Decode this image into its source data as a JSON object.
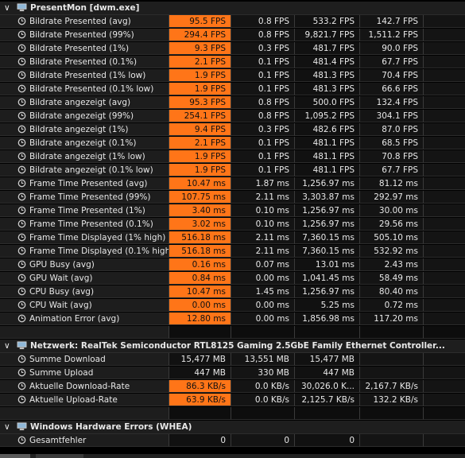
{
  "sections": [
    {
      "title": "PresentMon [dwm.exe]",
      "rows": [
        {
          "name": "Bildrate Presented (avg)",
          "values": [
            "95.5 FPS",
            "0.8 FPS",
            "533.2 FPS",
            "142.7 FPS"
          ],
          "highlight": true
        },
        {
          "name": "Bildrate Presented (99%)",
          "values": [
            "294.4 FPS",
            "0.8 FPS",
            "9,821.7 FPS",
            "1,511.2 FPS"
          ],
          "highlight": true
        },
        {
          "name": "Bildrate Presented (1%)",
          "values": [
            "9.3 FPS",
            "0.3 FPS",
            "481.7 FPS",
            "90.0 FPS"
          ],
          "highlight": true
        },
        {
          "name": "Bildrate Presented (0.1%)",
          "values": [
            "2.1 FPS",
            "0.1 FPS",
            "481.4 FPS",
            "67.7 FPS"
          ],
          "highlight": true
        },
        {
          "name": "Bildrate Presented (1% low)",
          "values": [
            "1.9 FPS",
            "0.1 FPS",
            "481.3 FPS",
            "70.4 FPS"
          ],
          "highlight": true
        },
        {
          "name": "Bildrate Presented (0.1% low)",
          "values": [
            "1.9 FPS",
            "0.1 FPS",
            "481.3 FPS",
            "66.6 FPS"
          ],
          "highlight": true
        },
        {
          "name": "Bildrate angezeigt (avg)",
          "values": [
            "95.3 FPS",
            "0.8 FPS",
            "500.0 FPS",
            "132.4 FPS"
          ],
          "highlight": true
        },
        {
          "name": "Bildrate angezeigt (99%)",
          "values": [
            "254.1 FPS",
            "0.8 FPS",
            "1,095.2 FPS",
            "304.1 FPS"
          ],
          "highlight": true
        },
        {
          "name": "Bildrate angezeigt (1%)",
          "values": [
            "9.4 FPS",
            "0.3 FPS",
            "482.6 FPS",
            "87.0 FPS"
          ],
          "highlight": true
        },
        {
          "name": "Bildrate angezeigt (0.1%)",
          "values": [
            "2.1 FPS",
            "0.1 FPS",
            "481.1 FPS",
            "68.5 FPS"
          ],
          "highlight": true
        },
        {
          "name": "Bildrate angezeigt (1% low)",
          "values": [
            "1.9 FPS",
            "0.1 FPS",
            "481.1 FPS",
            "70.8 FPS"
          ],
          "highlight": true
        },
        {
          "name": "Bildrate angezeigt (0.1% low)",
          "values": [
            "1.9 FPS",
            "0.1 FPS",
            "481.1 FPS",
            "67.7 FPS"
          ],
          "highlight": true
        },
        {
          "name": "Frame Time Presented (avg)",
          "values": [
            "10.47 ms",
            "1.87 ms",
            "1,256.97 ms",
            "81.12 ms"
          ],
          "highlight": true
        },
        {
          "name": "Frame Time Presented (99%)",
          "values": [
            "107.75 ms",
            "2.11 ms",
            "3,303.87 ms",
            "292.97 ms"
          ],
          "highlight": true
        },
        {
          "name": "Frame Time Presented (1%)",
          "values": [
            "3.40 ms",
            "0.10 ms",
            "1,256.97 ms",
            "30.00 ms"
          ],
          "highlight": true
        },
        {
          "name": "Frame Time Presented (0.1%)",
          "values": [
            "3.02 ms",
            "0.10 ms",
            "1,256.97 ms",
            "29.56 ms"
          ],
          "highlight": true
        },
        {
          "name": "Frame Time Displayed (1% high)",
          "values": [
            "516.18 ms",
            "2.11 ms",
            "7,360.15 ms",
            "505.10 ms"
          ],
          "highlight": true
        },
        {
          "name": "Frame Time Displayed (0.1% high)",
          "values": [
            "516.18 ms",
            "2.11 ms",
            "7,360.15 ms",
            "532.92 ms"
          ],
          "highlight": true
        },
        {
          "name": "GPU Busy (avg)",
          "values": [
            "0.16 ms",
            "0.07 ms",
            "13.01 ms",
            "2.43 ms"
          ],
          "highlight": true
        },
        {
          "name": "GPU Wait (avg)",
          "values": [
            "0.84 ms",
            "0.00 ms",
            "1,041.45 ms",
            "58.49 ms"
          ],
          "highlight": true
        },
        {
          "name": "CPU Busy (avg)",
          "values": [
            "10.47 ms",
            "1.45 ms",
            "1,256.97 ms",
            "80.40 ms"
          ],
          "highlight": true
        },
        {
          "name": "CPU Wait (avg)",
          "values": [
            "0.00 ms",
            "0.00 ms",
            "5.25 ms",
            "0.72 ms"
          ],
          "highlight": true
        },
        {
          "name": "Animation Error (avg)",
          "values": [
            "12.80 ms",
            "0.00 ms",
            "1,856.98 ms",
            "117.20 ms"
          ],
          "highlight": true
        }
      ]
    },
    {
      "title": "Netzwerk: RealTek Semiconductor RTL8125 Gaming 2.5GbE Family Ethernet Controller...",
      "rows": [
        {
          "name": "Summe Download",
          "values": [
            "15,477 MB",
            "13,551 MB",
            "15,477 MB",
            ""
          ],
          "highlight": false
        },
        {
          "name": "Summe Upload",
          "values": [
            "447 MB",
            "330 MB",
            "447 MB",
            ""
          ],
          "highlight": false
        },
        {
          "name": "Aktuelle Download-Rate",
          "values": [
            "86.3 KB/s",
            "0.0 KB/s",
            "30,026.0 K...",
            "2,167.7 KB/s"
          ],
          "highlight": true
        },
        {
          "name": "Aktuelle Upload-Rate",
          "values": [
            "63.9 KB/s",
            "0.0 KB/s",
            "2,125.7 KB/s",
            "132.2 KB/s"
          ],
          "highlight": true
        }
      ]
    },
    {
      "title": "Windows Hardware Errors (WHEA)",
      "rows": [
        {
          "name": "Gesamtfehler",
          "values": [
            "0",
            "0",
            "0",
            ""
          ],
          "highlight": false
        }
      ]
    }
  ]
}
